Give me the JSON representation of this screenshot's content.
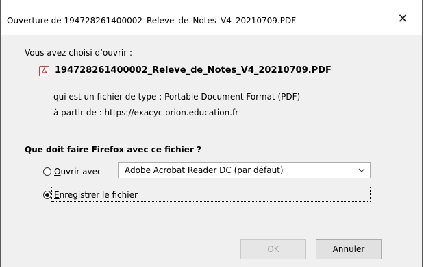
{
  "window": {
    "title": "Ouverture de 194728261400002_Releve_de_Notes_V4_20210709.PDF",
    "close_symbol": "✕"
  },
  "content": {
    "chose_label": "Vous avez choisi d’ouvrir :",
    "file_icon": "pdf-icon",
    "file_name": "194728261400002_Releve_de_Notes_V4_20210709.PDF",
    "type_line": "qui est un fichier de type : Portable Document Format (PDF)",
    "from_line": "à partir de : https://exacyc.orion.education.fr",
    "question": "Que doit faire Firefox avec ce fichier ?"
  },
  "options": {
    "open_with": {
      "label_first": "O",
      "label_rest": "uvrir avec",
      "checked": false
    },
    "app_select": {
      "value": "Adobe Acrobat Reader DC (par défaut)"
    },
    "save_file": {
      "label_first": "E",
      "label_rest": "nregistrer le fichier",
      "checked": true
    }
  },
  "buttons": {
    "ok": "OK",
    "cancel": "Annuler"
  },
  "colors": {
    "dialog_bg": "#f0f0f0",
    "pdf_red": "#d33333",
    "disabled_text": "#a0a0a0"
  }
}
